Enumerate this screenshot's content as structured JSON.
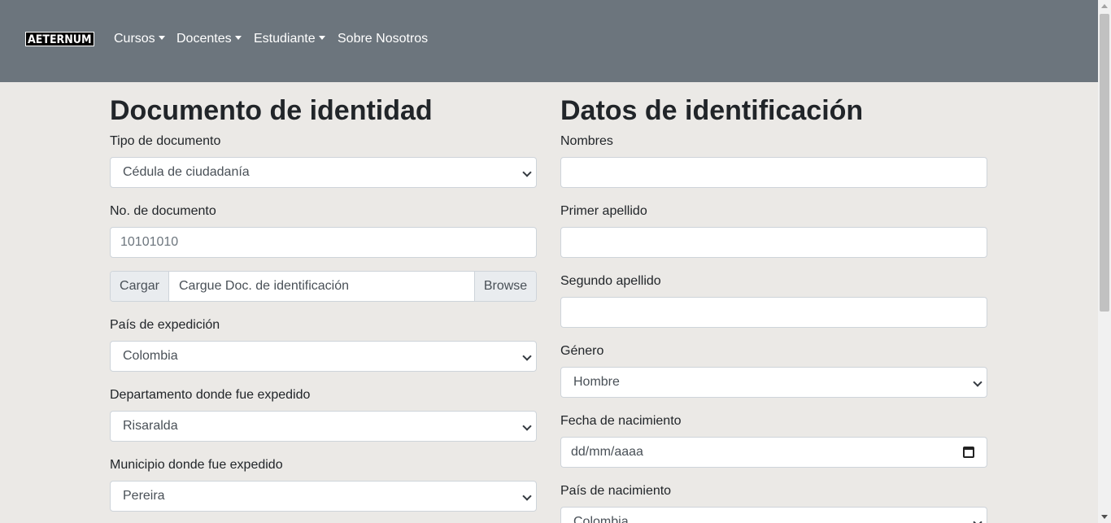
{
  "navbar": {
    "brand": "AETERNUM",
    "items": [
      {
        "label": "Cursos",
        "dropdown": true
      },
      {
        "label": "Docentes",
        "dropdown": true
      },
      {
        "label": "Estudiante",
        "dropdown": true
      },
      {
        "label": "Sobre Nosotros",
        "dropdown": false
      }
    ]
  },
  "left": {
    "title": "Documento de identidad",
    "tipo_doc": {
      "label": "Tipo de documento",
      "value": "Cédula de ciudadanía"
    },
    "num_doc": {
      "label": "No. de documento",
      "placeholder": "10101010"
    },
    "upload": {
      "prepend": "Cargar",
      "text": "Cargue Doc. de identificación",
      "browse": "Browse"
    },
    "pais_exp": {
      "label": "País de expedición",
      "value": "Colombia"
    },
    "depto_exp": {
      "label": "Departamento donde fue expedido",
      "value": "Risaralda"
    },
    "muni_exp": {
      "label": "Municipio donde fue expedido",
      "value": "Pereira"
    }
  },
  "right": {
    "title": "Datos de identificación",
    "nombres": {
      "label": "Nombres",
      "value": ""
    },
    "primer_apellido": {
      "label": "Primer apellido",
      "value": ""
    },
    "segundo_apellido": {
      "label": "Segundo apellido",
      "value": ""
    },
    "genero": {
      "label": "Género",
      "value": "Hombre"
    },
    "fecha_nac": {
      "label": "Fecha de nacimiento",
      "placeholder": "dd/mm/aaaa"
    },
    "pais_nac": {
      "label": "País de nacimiento",
      "value": "Colombia"
    }
  },
  "colors": {
    "navbar": "#6c757d",
    "background": "#ebe9e6",
    "text": "#212529"
  },
  "icons": [
    "caret-down-icon",
    "chevron-down-icon",
    "calendar-icon"
  ]
}
